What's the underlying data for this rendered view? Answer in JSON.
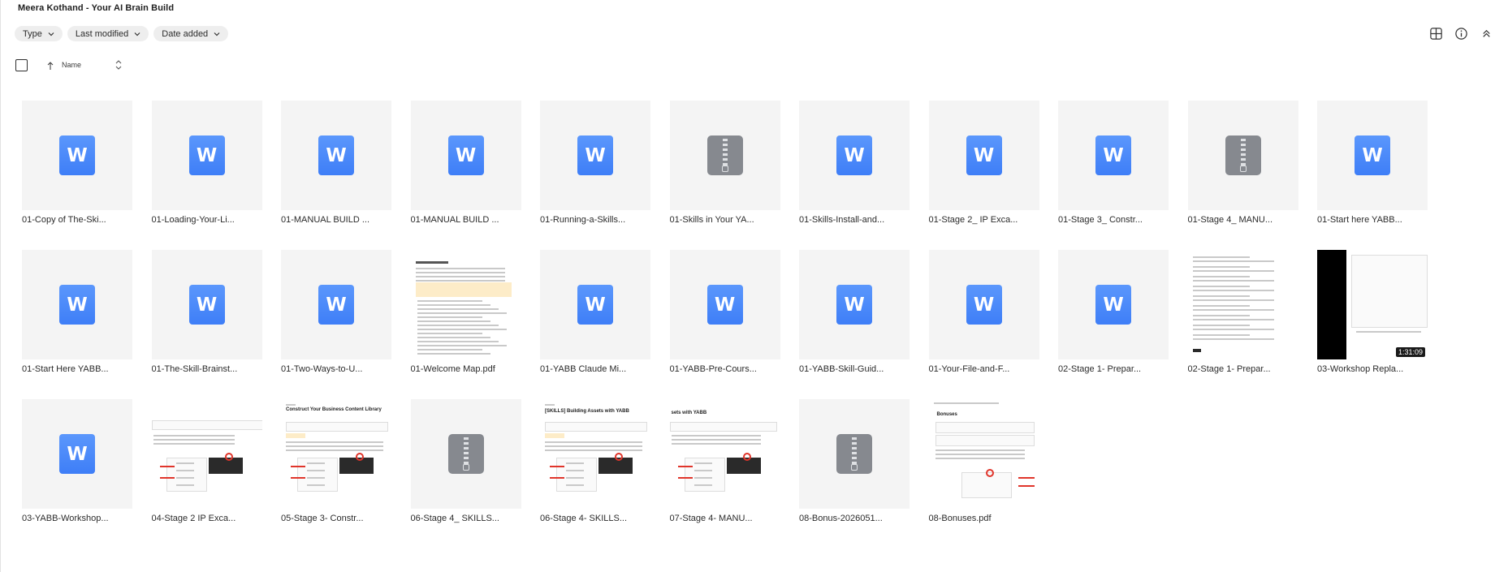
{
  "title": "Meera Kothand - Your AI Brain Build",
  "filters": [
    {
      "label": "Type"
    },
    {
      "label": "Last modified"
    },
    {
      "label": "Date added"
    }
  ],
  "toolbar_icons": [
    "grid-view-icon",
    "info-icon",
    "collapse-icon"
  ],
  "list_header": {
    "name_label": "Name",
    "sort_direction": "ascending"
  },
  "files": [
    {
      "name": "01-Copy of The-Ski...",
      "kind": "word"
    },
    {
      "name": "01-Loading-Your-Li...",
      "kind": "word"
    },
    {
      "name": "01-MANUAL BUILD ...",
      "kind": "word"
    },
    {
      "name": "01-MANUAL BUILD ...",
      "kind": "word"
    },
    {
      "name": "01-Running-a-Skills...",
      "kind": "word"
    },
    {
      "name": "01-Skills in Your YA...",
      "kind": "zip"
    },
    {
      "name": "01-Skills-Install-and...",
      "kind": "word"
    },
    {
      "name": "01-Stage 2_ IP Exca...",
      "kind": "word"
    },
    {
      "name": "01-Stage 3_ Constr...",
      "kind": "word"
    },
    {
      "name": "01-Stage 4_ MANU...",
      "kind": "zip"
    },
    {
      "name": "01-Start here YABB...",
      "kind": "word"
    },
    {
      "name": "01-Start Here YABB...",
      "kind": "word"
    },
    {
      "name": "01-The-Skill-Brainst...",
      "kind": "word"
    },
    {
      "name": "01-Two-Ways-to-U...",
      "kind": "word"
    },
    {
      "name": "01-Welcome Map.pdf",
      "kind": "pdf-welcome"
    },
    {
      "name": "01-YABB Claude Mi...",
      "kind": "word"
    },
    {
      "name": "01-YABB-Pre-Cours...",
      "kind": "word"
    },
    {
      "name": "01-YABB-Skill-Guid...",
      "kind": "word"
    },
    {
      "name": "01-Your-File-and-F...",
      "kind": "word"
    },
    {
      "name": "02-Stage 1- Prepar...",
      "kind": "word"
    },
    {
      "name": "02-Stage 1- Prepar...",
      "kind": "form"
    },
    {
      "name": "03-Workshop Repla...",
      "kind": "video",
      "duration": "1:31:09"
    },
    {
      "name": "03-YABB-Workshop...",
      "kind": "word"
    },
    {
      "name": "04-Stage 2 IP Exca...",
      "kind": "screenshot-a"
    },
    {
      "name": "05-Stage 3- Constr...",
      "kind": "screenshot-b",
      "heading": "Construct Your Business Content Library"
    },
    {
      "name": "06-Stage 4_ SKILLS...",
      "kind": "zip"
    },
    {
      "name": "06-Stage 4- SKILLS...",
      "kind": "screenshot-c",
      "heading": "[SKILLS] Building Assets with YABB"
    },
    {
      "name": "07-Stage 4- MANU...",
      "kind": "screenshot-d",
      "heading": "sets with YABB"
    },
    {
      "name": "08-Bonus-2026051...",
      "kind": "zip"
    },
    {
      "name": "08-Bonuses.pdf",
      "kind": "screenshot-e",
      "heading": "Bonuses"
    }
  ],
  "colors": {
    "word_badge": "#4285f4",
    "zip_badge": "#86898f",
    "tile_bg": "#f4f4f4",
    "chip_bg": "#eeeeee"
  }
}
